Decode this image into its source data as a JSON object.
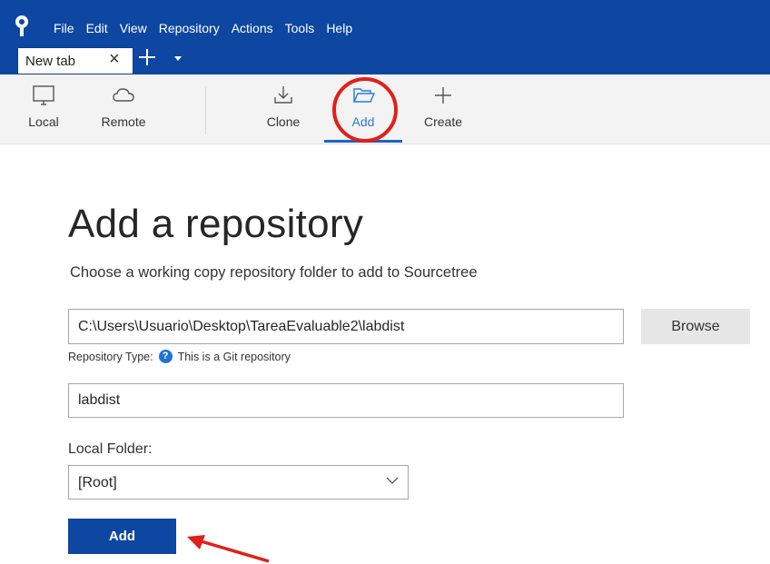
{
  "menu": {
    "items": [
      "File",
      "Edit",
      "View",
      "Repository",
      "Actions",
      "Tools",
      "Help"
    ]
  },
  "tabs": {
    "current_label": "New tab"
  },
  "toolbar": {
    "items": [
      {
        "label": "Local",
        "icon": "monitor-icon"
      },
      {
        "label": "Remote",
        "icon": "cloud-icon"
      },
      {
        "label": "Clone",
        "icon": "download-icon"
      },
      {
        "label": "Add",
        "icon": "folder-open-icon",
        "active": true
      },
      {
        "label": "Create",
        "icon": "plus-icon"
      }
    ]
  },
  "main": {
    "title": "Add a repository",
    "subtitle": "Choose a working copy repository folder to add to Sourcetree",
    "path_value": "C:\\Users\\Usuario\\Desktop\\TareaEvaluable2\\labdist",
    "browse_label": "Browse",
    "repo_type_label": "Repository Type:",
    "repo_type_value": "This is a Git repository",
    "help_glyph": "?",
    "name_value": "labdist",
    "local_folder_label": "Local Folder:",
    "local_folder_value": "[Root]",
    "add_button_label": "Add"
  },
  "colors": {
    "titlebar": "#0d47a1",
    "accent": "#1e63c8",
    "add_button": "#0d47a1",
    "annotation": "#e0201b"
  }
}
